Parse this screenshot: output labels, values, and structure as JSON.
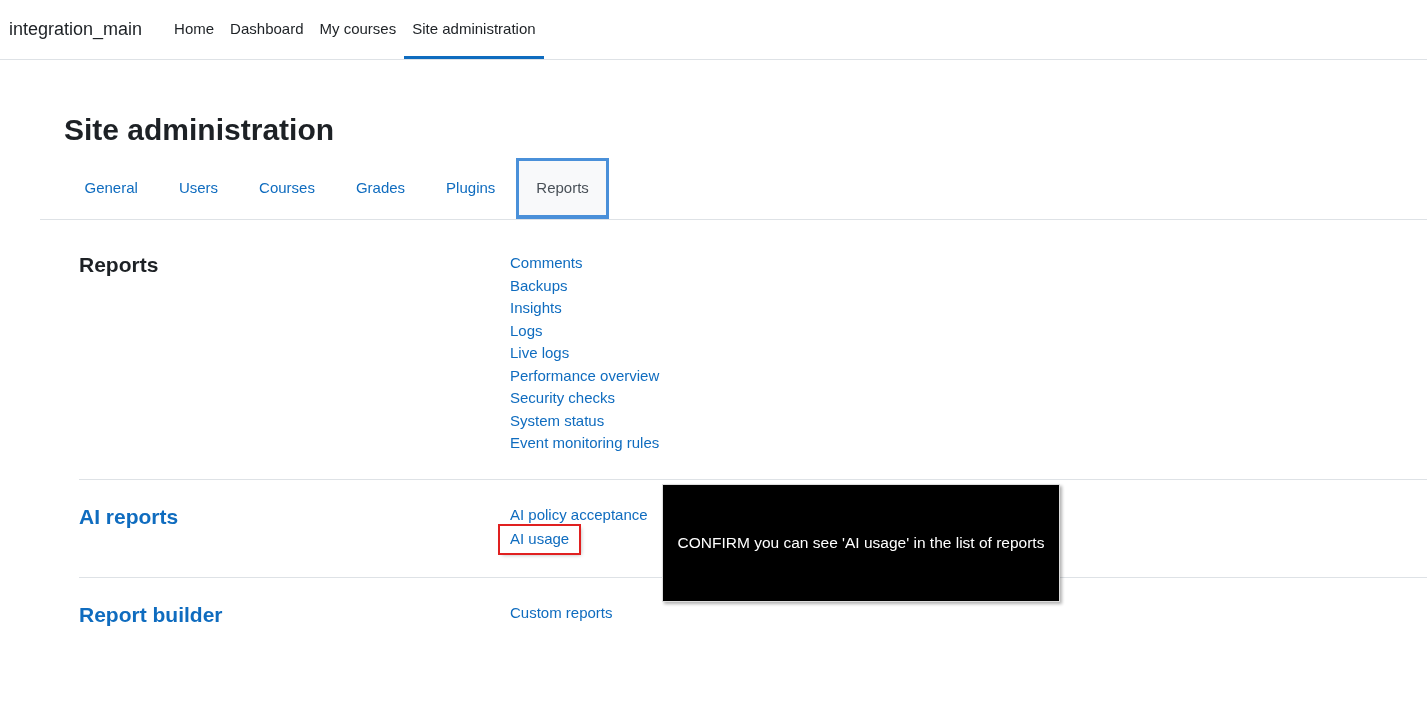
{
  "navbar": {
    "brand": "integration_main",
    "items": [
      {
        "label": "Home",
        "selected": false
      },
      {
        "label": "Dashboard",
        "selected": false
      },
      {
        "label": "My courses",
        "selected": false
      },
      {
        "label": "Site administration",
        "selected": true
      }
    ]
  },
  "page_title": "Site administration",
  "tabs": [
    {
      "label": "General",
      "selected": false
    },
    {
      "label": "Users",
      "selected": false
    },
    {
      "label": "Courses",
      "selected": false
    },
    {
      "label": "Grades",
      "selected": false
    },
    {
      "label": "Plugins",
      "selected": false
    },
    {
      "label": "Reports",
      "selected": true
    }
  ],
  "sections": [
    {
      "title": "Reports",
      "title_is_link": false,
      "links": [
        {
          "label": "Comments",
          "highlighted": false
        },
        {
          "label": "Backups",
          "highlighted": false
        },
        {
          "label": "Insights",
          "highlighted": false
        },
        {
          "label": "Logs",
          "highlighted": false
        },
        {
          "label": "Live logs",
          "highlighted": false
        },
        {
          "label": "Performance overview",
          "highlighted": false
        },
        {
          "label": "Security checks",
          "highlighted": false
        },
        {
          "label": "System status",
          "highlighted": false
        },
        {
          "label": "Event monitoring rules",
          "highlighted": false
        }
      ]
    },
    {
      "title": "AI reports",
      "title_is_link": true,
      "links": [
        {
          "label": "AI policy acceptance",
          "highlighted": false
        },
        {
          "label": "AI usage",
          "highlighted": true
        }
      ]
    },
    {
      "title": "Report builder",
      "title_is_link": true,
      "links": [
        {
          "label": "Custom reports",
          "highlighted": false
        }
      ]
    }
  ],
  "callout": {
    "text": "CONFIRM you can see 'AI usage' in the list of reports"
  }
}
